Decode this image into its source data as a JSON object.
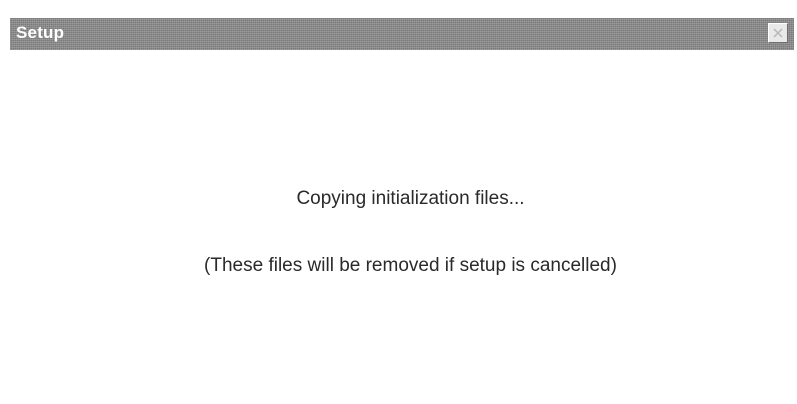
{
  "window": {
    "title": "Setup"
  },
  "content": {
    "status_message": "Copying initialization files...",
    "note_message": "(These files will be removed if setup is cancelled)"
  },
  "icons": {
    "close": "close-icon"
  },
  "colors": {
    "titlebar": "#8a8a8a",
    "title_text": "#ffffff",
    "background": "#ffffff",
    "message_text": "#2a2a2a"
  }
}
